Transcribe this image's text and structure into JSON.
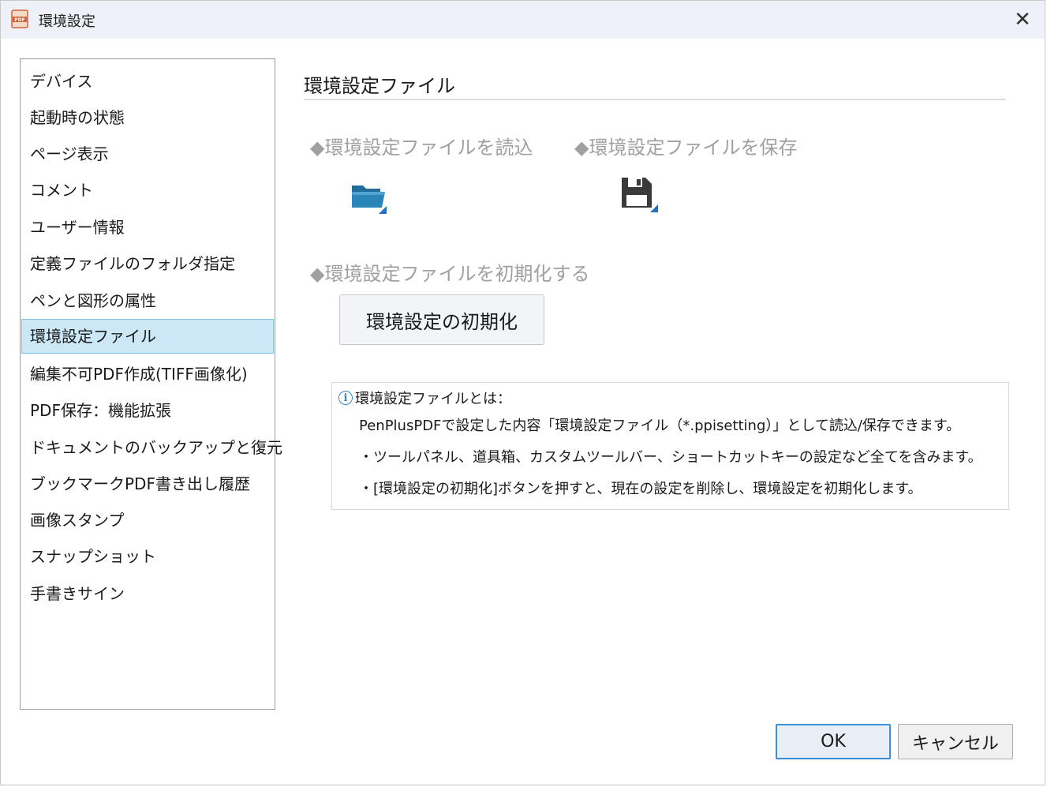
{
  "window": {
    "title": "環境設定",
    "app_icon_label": "PDF",
    "close_glyph": "✕"
  },
  "sidebar": {
    "items": [
      {
        "label": "デバイス",
        "selected": false
      },
      {
        "label": "起動時の状態",
        "selected": false
      },
      {
        "label": "ページ表示",
        "selected": false
      },
      {
        "label": "コメント",
        "selected": false
      },
      {
        "label": "ユーザー情報",
        "selected": false
      },
      {
        "label": "定義ファイルのフォルダ指定",
        "selected": false
      },
      {
        "label": "ペンと図形の属性",
        "selected": false
      },
      {
        "label": "環境設定ファイル",
        "selected": true
      },
      {
        "label": "編集不可PDF作成(TIFF画像化)",
        "selected": false
      },
      {
        "label": "PDF保存：機能拡張",
        "selected": false
      },
      {
        "label": "ドキュメントのバックアップと復元",
        "selected": false
      },
      {
        "label": "ブックマークPDF書き出し履歴",
        "selected": false
      },
      {
        "label": "画像スタンプ",
        "selected": false
      },
      {
        "label": "スナップショット",
        "selected": false
      },
      {
        "label": "手書きサイン",
        "selected": false
      }
    ]
  },
  "main": {
    "title": "環境設定ファイル",
    "load_label": "◆環境設定ファイルを読込",
    "save_label": "◆環境設定ファイルを保存",
    "reset_label": "◆環境設定ファイルを初期化する",
    "reset_button": "環境設定の初期化",
    "load_icon": "open-folder-icon",
    "save_icon": "floppy-disk-icon"
  },
  "info": {
    "heading": "環境設定ファイルとは：",
    "line1": "PenPlusPDFで設定した内容「環境設定ファイル（*.ppisetting）」として読込/保存できます。",
    "line2": "・ツールパネル、道具箱、カスタムツールバー、ショートカットキーの設定など全てを含みます。",
    "line3": "・[環境設定の初期化]ボタンを押すと、現在の設定を削除し、環境設定を初期化します。"
  },
  "footer": {
    "ok": "OK",
    "cancel": "キャンセル"
  },
  "colors": {
    "selected_bg": "#cce8f6",
    "accent": "#3c8ed6",
    "disabled_text": "#a0a0a0",
    "titlebar_bg": "#eef2f8"
  }
}
